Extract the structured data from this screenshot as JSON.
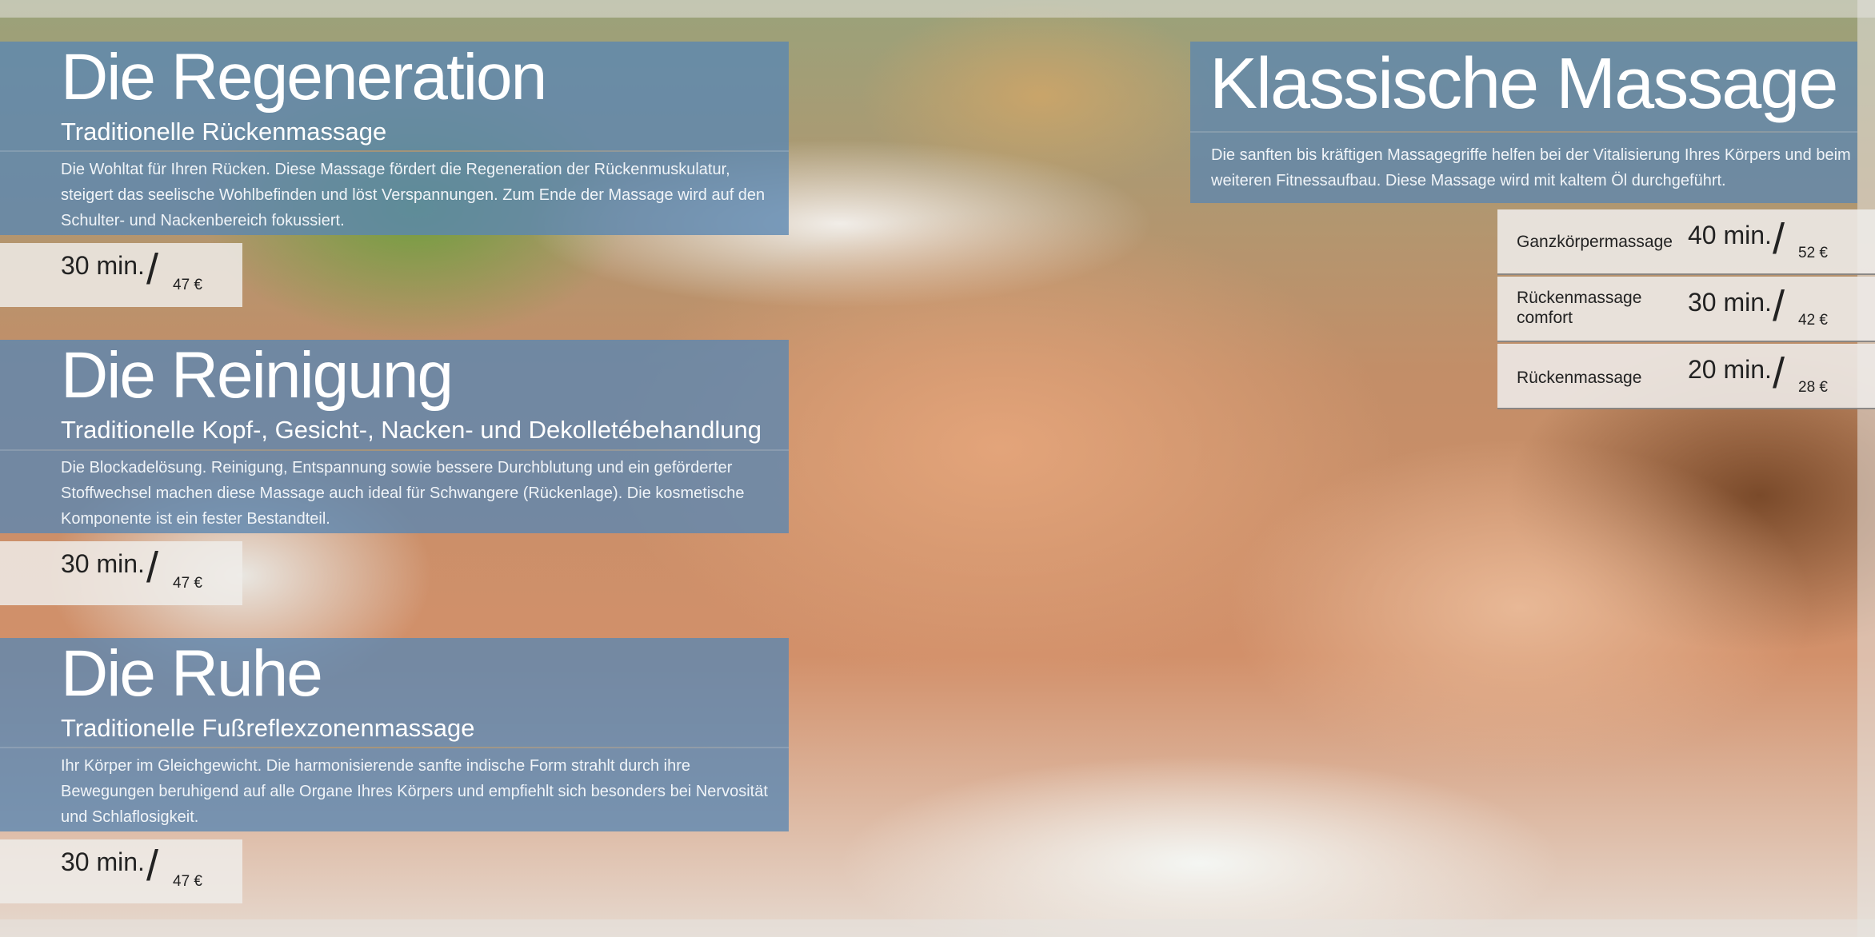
{
  "sections": [
    {
      "title": "Die Regeneration",
      "subtitle": "Traditionelle Rückenmassage",
      "description": "Die Wohltat für Ihren Rücken. Diese Massage fördert die Regeneration der Rückenmuskulatur, steigert das seelische Wohlbefinden und löst Verspannungen. Zum Ende der Massage wird auf den Schulter- und Nackenbereich fokussiert.",
      "duration": "30 min.",
      "price": "47 €"
    },
    {
      "title": "Die Reinigung",
      "subtitle": "Traditionelle Kopf-, Gesicht-, Nacken- und Dekolletébehandlung",
      "description": "Die Blockadelösung. Reinigung, Entspannung sowie bessere Durchblutung und ein geförderter Stoffwechsel machen diese Massage auch ideal für Schwangere (Rückenlage). Die kosmetische Komponente ist ein fester Bestandteil.",
      "duration": "30 min.",
      "price": "47 €"
    },
    {
      "title": "Die Ruhe",
      "subtitle": "Traditionelle Fußreflexzonenmassage",
      "description": "Ihr Körper im Gleichgewicht. Die harmonisierende sanfte indische Form strahlt durch ihre Bewegungen beruhigend auf alle Organe Ihres Körpers und empfiehlt sich besonders bei Nervosität und Schlaflosigkeit.",
      "duration": "30 min.",
      "price": "47 €"
    }
  ],
  "classic": {
    "title": "Klassische Massage",
    "description": "Die sanften bis kräftigen Massagegriffe helfen bei der Vitalisierung Ihres Körpers und beim weiteren Fitnessaufbau. Diese Massage wird mit kaltem Öl durchgeführt.",
    "items": [
      {
        "name": "Ganzkörpermassage",
        "duration": "40 min.",
        "price": "52 €"
      },
      {
        "name": "Rückenmassage comfort",
        "duration": "30 min.",
        "price": "42 €"
      },
      {
        "name": "Rückenmassage",
        "duration": "20 min.",
        "price": "28 €"
      }
    ]
  },
  "slash": "/"
}
